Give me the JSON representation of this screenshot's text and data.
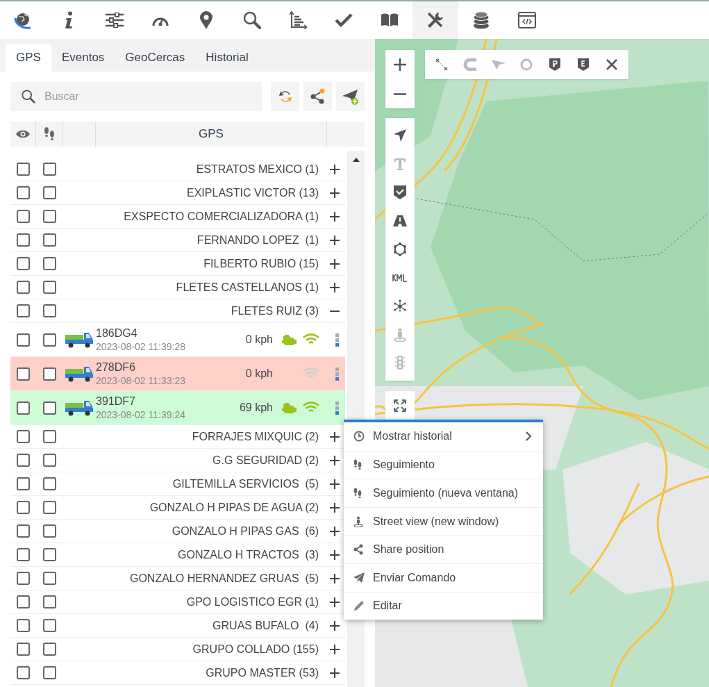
{
  "toolbar": [
    {
      "selected": false
    },
    {
      "selected": false
    },
    {
      "selected": false
    },
    {
      "selected": false
    },
    {
      "selected": false
    },
    {
      "selected": false
    },
    {
      "selected": false
    },
    {
      "selected": false
    },
    {
      "selected": false
    },
    {
      "selected": true
    },
    {
      "selected": false
    },
    {
      "selected": false
    }
  ],
  "tabs": [
    {
      "label": "GPS",
      "selected": true
    },
    {
      "label": "Eventos",
      "selected": false
    },
    {
      "label": "GeoCercas",
      "selected": false
    },
    {
      "label": "Historial",
      "selected": false
    }
  ],
  "search": {
    "placeholder": "Buscar"
  },
  "table": {
    "columns": [
      "GPS"
    ],
    "rows": [
      {
        "kind": "group",
        "label": "ESTRATOS MEXICO (1)",
        "visible": false,
        "follow": false,
        "expanded": false
      },
      {
        "kind": "group",
        "label": "EXIPLASTIC VICTOR (13)",
        "visible": false,
        "follow": false,
        "expanded": false
      },
      {
        "kind": "group",
        "label": "EXSPECTO COMERCIALIZADORA (1)",
        "visible": false,
        "follow": false,
        "expanded": false
      },
      {
        "kind": "group",
        "label": "FERNANDO LOPEZ  (1)",
        "visible": false,
        "follow": false,
        "expanded": false
      },
      {
        "kind": "group",
        "label": "FILBERTO RUBIO (15)",
        "visible": false,
        "follow": false,
        "expanded": false
      },
      {
        "kind": "group",
        "label": "FLETES CASTELLANOS (1)",
        "visible": false,
        "follow": false,
        "expanded": false
      },
      {
        "kind": "group",
        "label": "FLETES RUIZ (3)",
        "visible": false,
        "follow": false,
        "expanded": true,
        "children": [
          {
            "kind": "vehicle",
            "name": "186DG4",
            "time": "2023-08-02 11:39:28",
            "speed": "0 kph",
            "visible": false,
            "follow": false,
            "color": "#ffffff",
            "engine_on": true,
            "signal": true
          },
          {
            "kind": "vehicle",
            "name": "278DF6",
            "time": "2023-08-02 11:33:23",
            "speed": "0 kph",
            "visible": false,
            "follow": false,
            "color": "#fdd0c8",
            "engine_on": false,
            "signal": false
          },
          {
            "kind": "vehicle",
            "name": "391DF7",
            "time": "2023-08-02 11:39:24",
            "speed": "69 kph",
            "visible": false,
            "follow": false,
            "color": "#ccfbd5",
            "engine_on": true,
            "signal": true
          }
        ]
      },
      {
        "kind": "group",
        "label": "FORRAJES MIXQUIC (2)",
        "visible": false,
        "follow": false,
        "expanded": false
      },
      {
        "kind": "group",
        "label": "G.G SEGURIDAD (2)",
        "visible": false,
        "follow": false,
        "expanded": false
      },
      {
        "kind": "group",
        "label": "GILTEMILLA SERVICIOS  (5)",
        "visible": false,
        "follow": false,
        "expanded": false
      },
      {
        "kind": "group",
        "label": "GONZALO H PIPAS DE AGUA (2)",
        "visible": false,
        "follow": false,
        "expanded": false
      },
      {
        "kind": "group",
        "label": "GONZALO H PIPAS GAS  (6)",
        "visible": false,
        "follow": false,
        "expanded": false
      },
      {
        "kind": "group",
        "label": "GONZALO H TRACTOS  (3)",
        "visible": false,
        "follow": false,
        "expanded": false
      },
      {
        "kind": "group",
        "label": "GONZALO HERNANDEZ GRUAS  (5)",
        "visible": false,
        "follow": false,
        "expanded": false
      },
      {
        "kind": "group",
        "label": "GPO LOGISTICO EGR (1)",
        "visible": false,
        "follow": false,
        "expanded": false
      },
      {
        "kind": "group",
        "label": "GRUAS BUFALO  (4)",
        "visible": false,
        "follow": false,
        "expanded": false
      },
      {
        "kind": "group",
        "label": "GRUPO COLLADO (155)",
        "visible": false,
        "follow": false,
        "expanded": false
      },
      {
        "kind": "group",
        "label": "GRUPO MASTER (53)",
        "visible": false,
        "follow": false,
        "expanded": false
      }
    ]
  },
  "context_menu": {
    "items": [
      {
        "kind": "history",
        "label": "Mostrar historial",
        "submenu": true
      },
      {
        "kind": "follow",
        "label": "Seguimiento",
        "submenu": false
      },
      {
        "kind": "follow",
        "label": "Seguimiento (nueva ventana)",
        "submenu": false
      },
      {
        "kind": "streetview",
        "label": "Street view (new window)",
        "submenu": false
      },
      {
        "kind": "share",
        "label": "Share position",
        "submenu": false
      },
      {
        "kind": "command",
        "label": "Enviar Comando",
        "submenu": false
      },
      {
        "kind": "edit",
        "label": "Editar",
        "submenu": false
      }
    ]
  }
}
